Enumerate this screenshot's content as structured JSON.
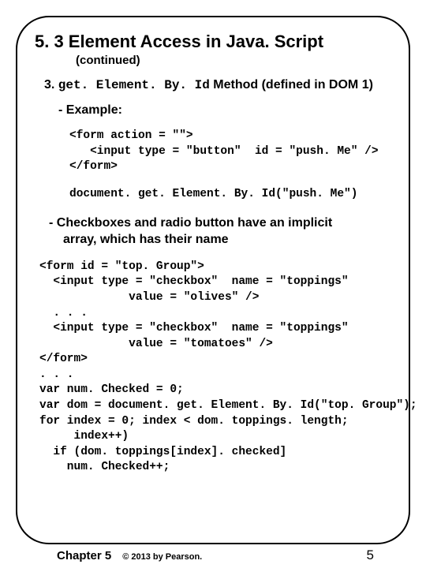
{
  "title": "5. 3 Element Access in Java. Script",
  "subtitle": "(continued)",
  "section3": {
    "prefix": "3. ",
    "code": "get. Element. By. Id",
    "suffix": " Method (defined in DOM 1)"
  },
  "exampleLabel": "- Example:",
  "code1": {
    "l1": "<form action = \"\">",
    "l2": "   <input type = \"button\"  id = \"push. Me\" />",
    "l3": "</form>"
  },
  "docCall": "document. get. Element. By. Id(\"push. Me\")",
  "implicit": {
    "l1": "- Checkboxes and radio button have an implicit",
    "l2": "array, which has their name"
  },
  "code2": {
    "l1": "<form id = \"top. Group\">",
    "l2": "  <input type = \"checkbox\"  name = \"toppings\"",
    "l3": "             value = \"olives\" />",
    "l4": "  . . .",
    "l5": "  <input type = \"checkbox\"  name = \"toppings\"",
    "l6": "             value = \"tomatoes\" />",
    "l7": "</form>",
    "l8": ". . .",
    "l9": "var num. Checked = 0;",
    "l10": "var dom = document. get. Element. By. Id(\"top. Group\");",
    "l11": "for index = 0; index < dom. toppings. length;",
    "l12": "     index++)",
    "l13": "  if (dom. toppings[index]. checked]",
    "l14": "    num. Checked++;"
  },
  "footer": {
    "chapter": "Chapter 5",
    "copyright": "© 2013 by Pearson.",
    "page": "5"
  }
}
